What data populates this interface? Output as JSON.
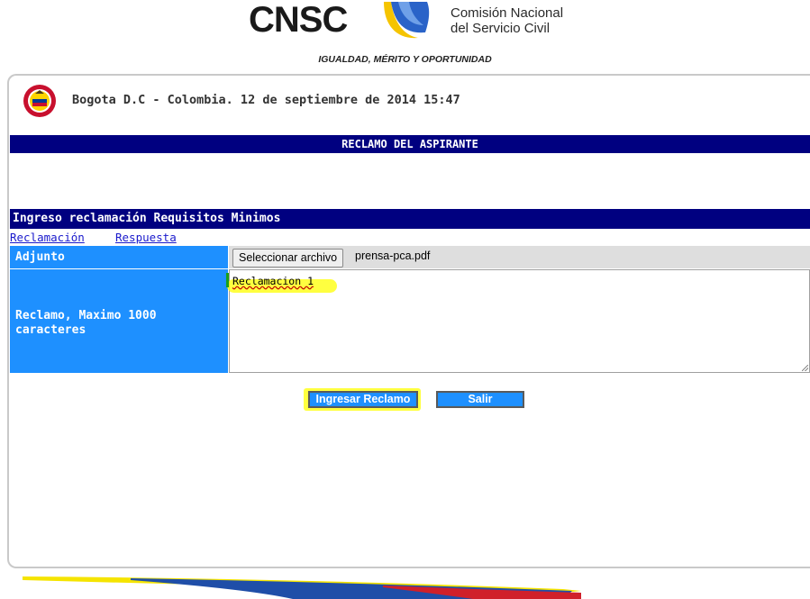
{
  "header": {
    "brand": "CNSC",
    "name_line1": "Comisión Nacional",
    "name_line2": "del Servicio Civil",
    "motto": "IGUALDAD, MÉRITO Y OPORTUNIDAD"
  },
  "location_date": "Bogota D.C - Colombia. 12 de septiembre de 2014 15:47",
  "page_title": "RECLAMO DEL ASPIRANTE",
  "section_title": "Ingreso reclamación Requisitos Minimos",
  "tabs": [
    {
      "label": "Reclamación"
    },
    {
      "label": "Respuesta"
    }
  ],
  "form": {
    "attachment_label": "Adjunto",
    "file_button": "Seleccionar archivo",
    "file_name": "prensa-pca.pdf",
    "claim_label": "Reclamo, Maximo 1000 caracteres",
    "claim_value": "Reclamacion 1"
  },
  "buttons": {
    "submit": "Ingresar Reclamo",
    "exit": "Salir"
  },
  "colors": {
    "navy": "#000080",
    "label_blue": "#1e90ff",
    "highlight": "#ffff00"
  }
}
